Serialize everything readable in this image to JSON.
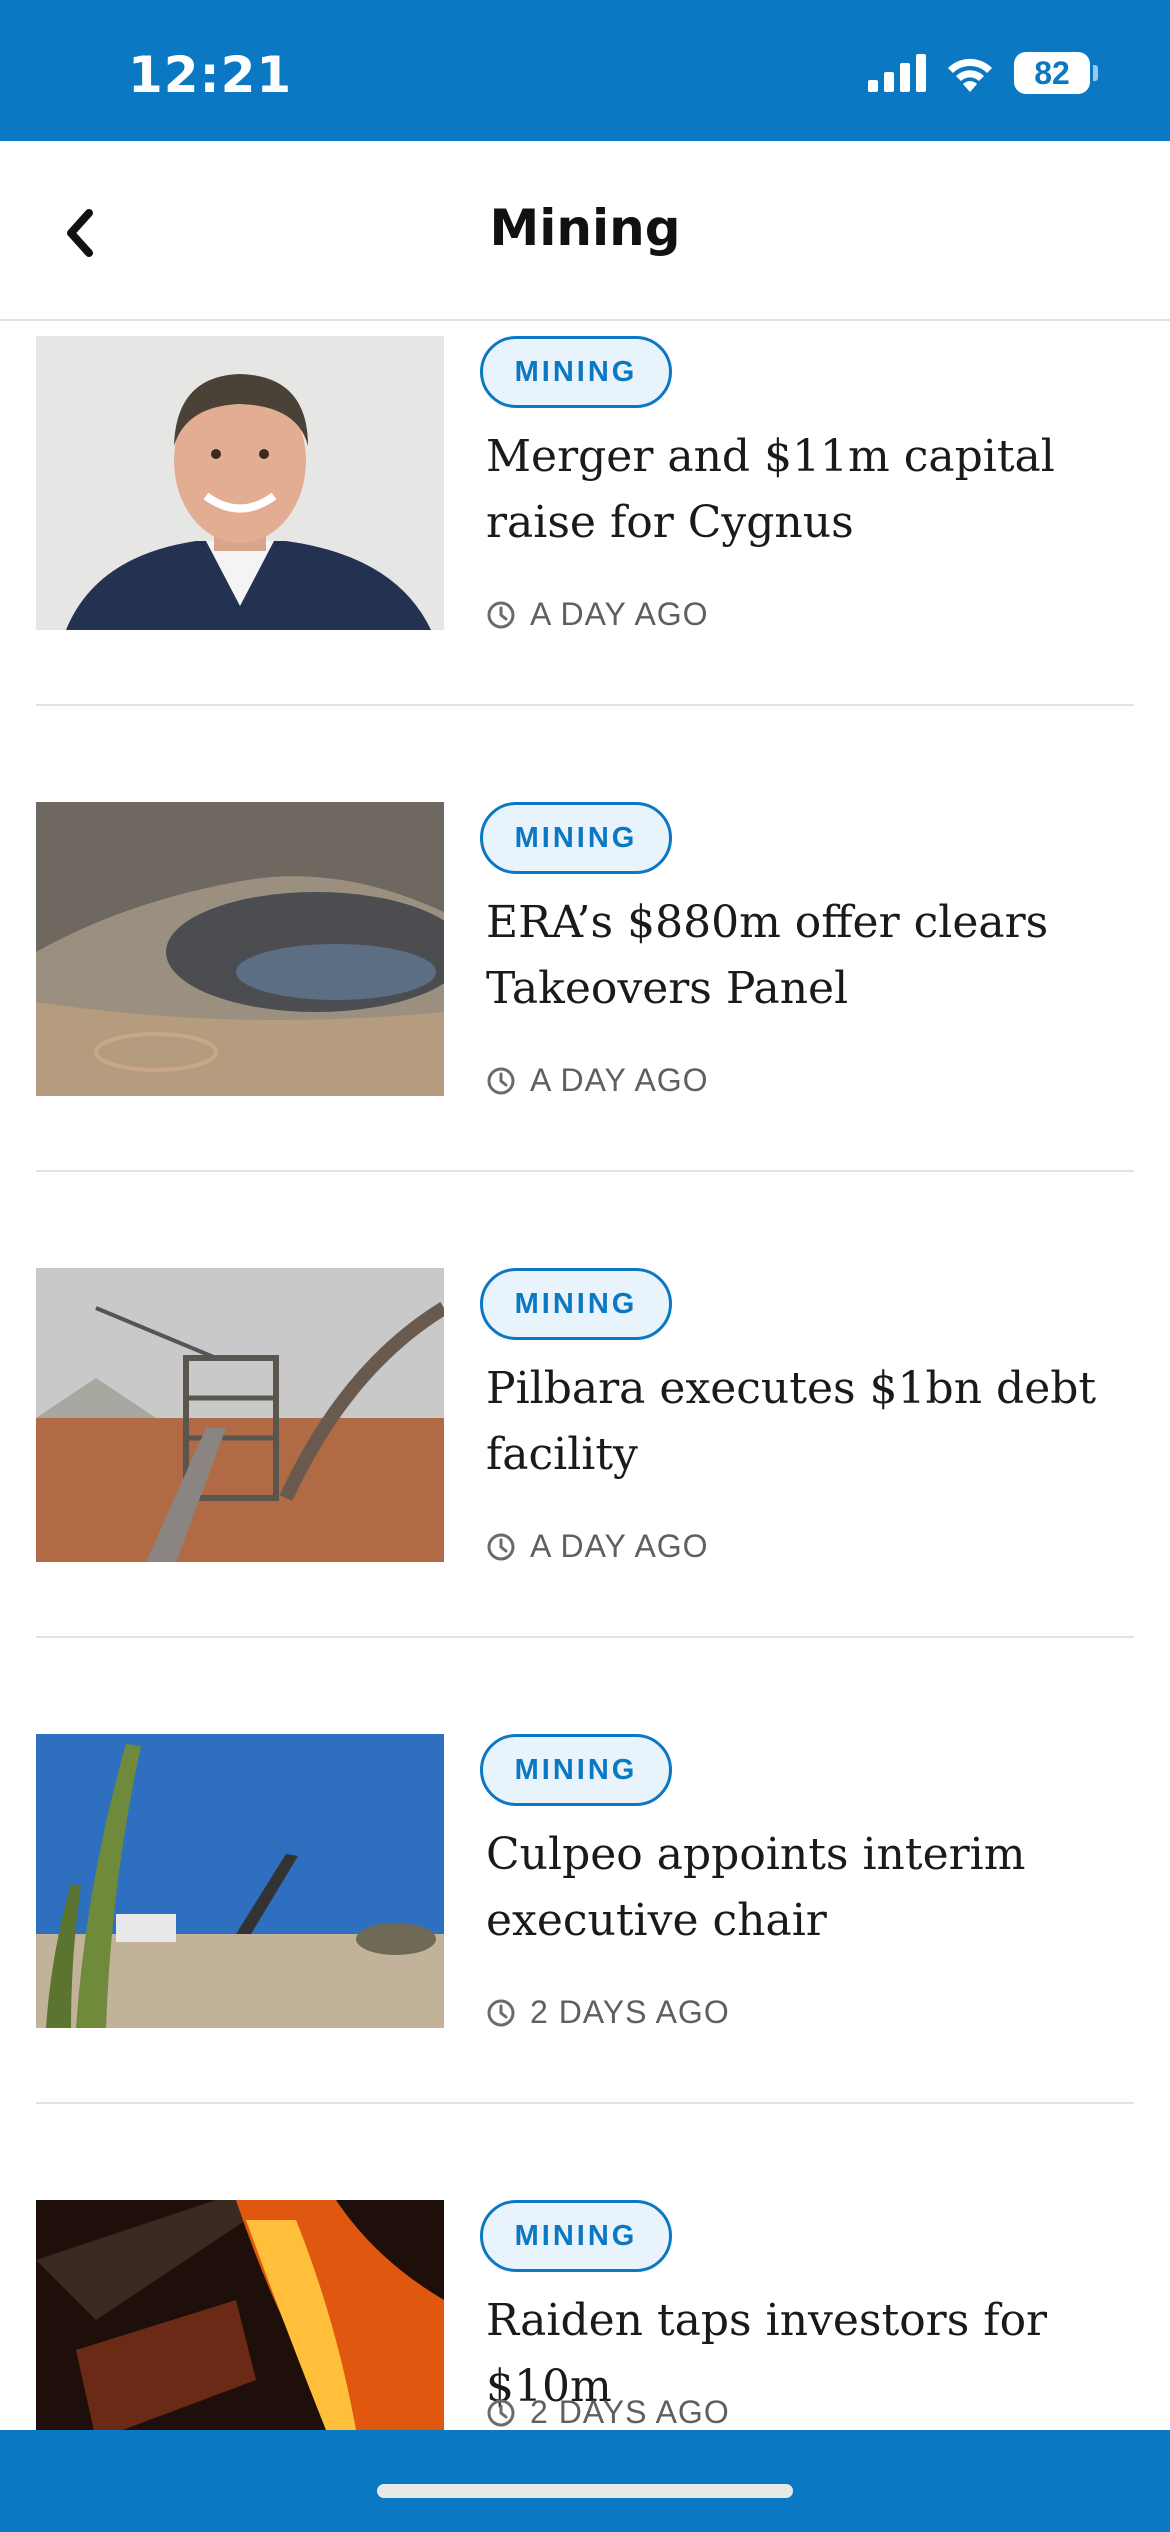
{
  "status_bar": {
    "time": "12:21",
    "battery": "82"
  },
  "header": {
    "title": "Mining",
    "back_icon": "chevron-left-icon"
  },
  "articles": [
    {
      "category": "MINING",
      "title": "Merger and $11m capital raise for Cygnus",
      "time": "A DAY AGO"
    },
    {
      "category": "MINING",
      "title": "ERA’s $880m offer clears Takeovers Panel",
      "time": "A DAY AGO"
    },
    {
      "category": "MINING",
      "title": "Pilbara executes $1bn debt facility",
      "time": "A DAY AGO"
    },
    {
      "category": "MINING",
      "title": "Culpeo appoints interim executive chair",
      "time": "2 DAYS AGO"
    },
    {
      "category": "MINING",
      "title": "Raiden taps investors for $10m",
      "time": "2 DAYS AGO"
    }
  ],
  "colors": {
    "brand": "#0a78c2",
    "badge_bg": "#e8f3fb"
  }
}
